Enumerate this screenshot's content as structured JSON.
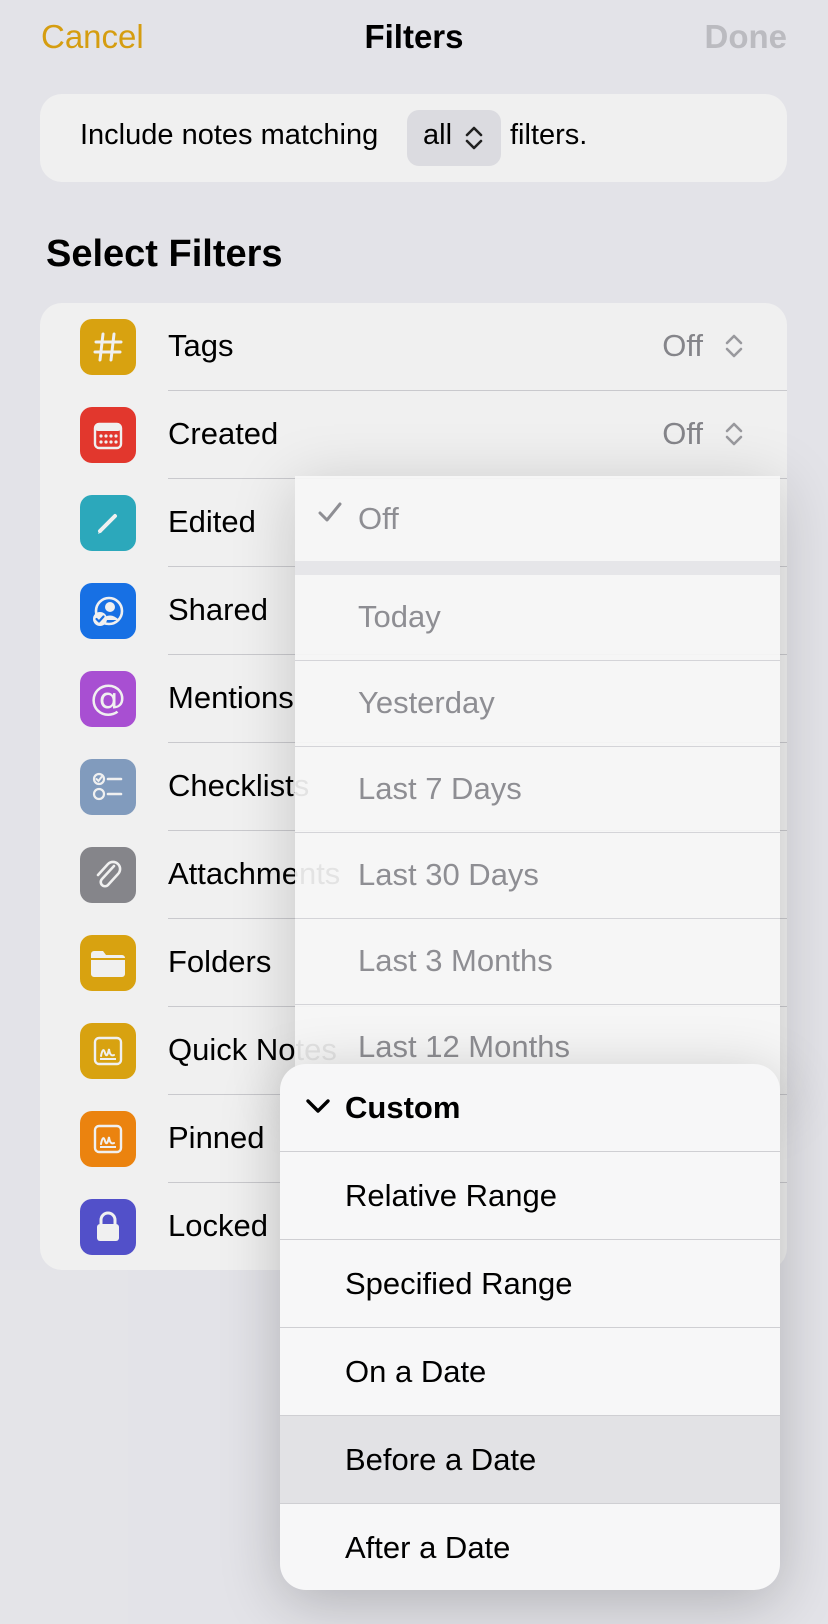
{
  "nav": {
    "cancel_label": "Cancel",
    "title": "Filters",
    "done_label": "Done"
  },
  "match": {
    "prefix": "Include notes matching",
    "selected": "all",
    "suffix": "filters."
  },
  "section_title": "Select Filters",
  "colors": {
    "accent": "#e3a712"
  },
  "filters": [
    {
      "label": "Tags",
      "icon": "hashtag-icon",
      "color": "#e6ad12",
      "value": "Off"
    },
    {
      "label": "Created",
      "icon": "calendar-icon",
      "color": "#f13b30",
      "value": "Off"
    },
    {
      "label": "Edited",
      "icon": "pencil-icon",
      "color": "#2fb3c7"
    },
    {
      "label": "Shared",
      "icon": "shared-person-icon",
      "color": "#1977f3"
    },
    {
      "label": "Mentions",
      "icon": "at-sign-icon",
      "color": "#b354e0"
    },
    {
      "label": "Checklists",
      "icon": "checklist-icon",
      "color": "#8aa5c9"
    },
    {
      "label": "Attachments",
      "icon": "paperclip-icon",
      "color": "#8e8e93"
    },
    {
      "label": "Folders",
      "icon": "folder-icon",
      "color": "#e6ad12"
    },
    {
      "label": "Quick Notes",
      "icon": "quick-note-icon",
      "color": "#e6ad12"
    },
    {
      "label": "Pinned",
      "icon": "pinned-note-icon",
      "color": "#fa8c10"
    },
    {
      "label": "Locked",
      "icon": "lock-icon",
      "color": "#5856d6"
    }
  ],
  "date_menu": {
    "options": [
      "Off",
      "Today",
      "Yesterday",
      "Last 7 Days",
      "Last 30 Days",
      "Last 3 Months",
      "Last 12 Months"
    ],
    "selected": "Off"
  },
  "custom_menu": {
    "header": "Custom",
    "options": [
      "Relative Range",
      "Specified Range",
      "On a Date",
      "Before a Date",
      "After a Date"
    ],
    "highlighted": "Before a Date"
  }
}
